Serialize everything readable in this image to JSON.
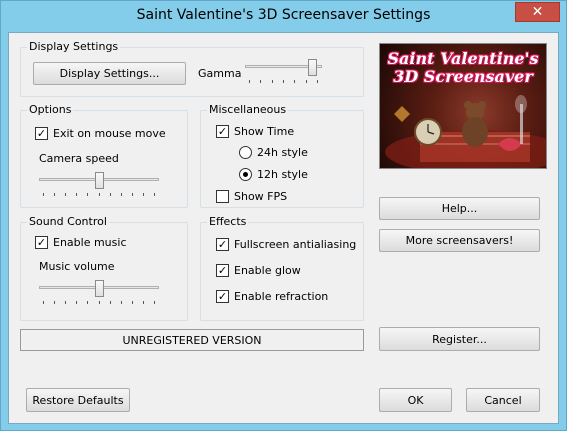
{
  "window": {
    "title": "Saint Valentine's 3D Screensaver Settings",
    "close_glyph": "✕"
  },
  "display_settings": {
    "legend": "Display Settings",
    "button_label": "Display Settings...",
    "gamma_label": "Gamma",
    "gamma_level": 0.92
  },
  "options": {
    "legend": "Options",
    "exit_on_mouse_move": {
      "label": "Exit on mouse move",
      "checked": true
    },
    "camera_speed_label": "Camera speed",
    "camera_speed_level": 0.5
  },
  "miscellaneous": {
    "legend": "Miscellaneous",
    "show_time": {
      "label": "Show Time",
      "checked": true
    },
    "style_24h": {
      "label": "24h style",
      "selected": false
    },
    "style_12h": {
      "label": "12h style",
      "selected": true
    },
    "show_fps": {
      "label": "Show FPS",
      "checked": false
    }
  },
  "sound_control": {
    "legend": "Sound Control",
    "enable_music": {
      "label": "Enable music",
      "checked": true
    },
    "music_volume_label": "Music volume",
    "music_volume_level": 0.5
  },
  "effects": {
    "legend": "Effects",
    "fullscreen_antialiasing": {
      "label": "Fullscreen antialiasing",
      "checked": true
    },
    "enable_glow": {
      "label": "Enable glow",
      "checked": true
    },
    "enable_refraction": {
      "label": "Enable refraction",
      "checked": true
    }
  },
  "preview": {
    "title": "Saint Valentine's 3D Screensaver"
  },
  "buttons": {
    "help": "Help...",
    "more_screensavers": "More screensavers!",
    "register": "Register...",
    "restore_defaults": "Restore Defaults",
    "ok": "OK",
    "cancel": "Cancel"
  },
  "status": {
    "unregistered": "UNREGISTERED VERSION"
  },
  "check_glyph": "✓"
}
